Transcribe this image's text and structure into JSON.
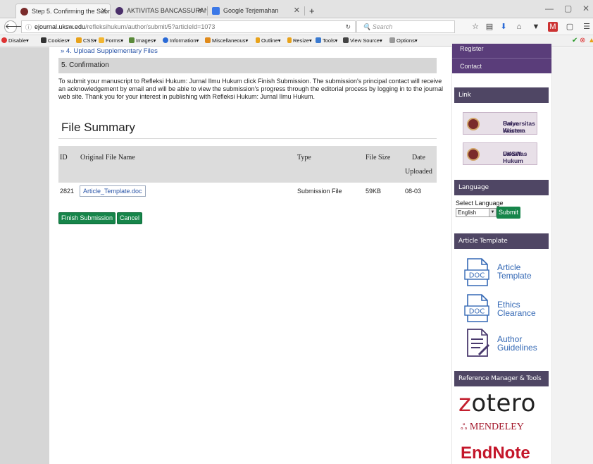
{
  "browser": {
    "tabs": [
      {
        "title": "Step 5. Confirming the Subr",
        "active": true
      },
      {
        "title": "AKTIVITAS BANCASSURANS",
        "active": false
      },
      {
        "title": "Google Terjemahan",
        "active": false
      }
    ],
    "new_tab": "+",
    "url_domain": "ejournal.uksw.edu",
    "url_path": "/refleksihukum/author/submit/5?articleId=1073",
    "search_placeholder": "Search"
  },
  "devbar": {
    "items": [
      "Disable",
      "Cookies",
      "CSS",
      "Forms",
      "Images",
      "Information",
      "Miscellaneous",
      "Outline",
      "Resize",
      "Tools",
      "View Source",
      "Options"
    ]
  },
  "main": {
    "step4_link": "» 4. Upload Supplementary Files",
    "step5_header": "5. Confirmation",
    "instructions": "To submit your manuscript to Refleksi Hukum: Jurnal Ilmu Hukum click Finish Submission. The submission's principal contact will receive an acknowledgement by email and will be able to view the submission's progress through the editorial process by logging in to the journal web site. Thank you for your interest in publishing with Refleksi Hukum: Jurnal Ilmu Hukum.",
    "file_summary_title": "File Summary",
    "table": {
      "headers": {
        "id": "ID",
        "name": "Original File Name",
        "type": "Type",
        "size": "File Size",
        "date_line1": "Date",
        "date_line2": "Uploaded"
      },
      "rows": [
        {
          "id": "2821",
          "name": "Article_Template.doc",
          "type": "Submission File",
          "size": "59KB",
          "date": "08-03"
        }
      ]
    },
    "finish_button": "Finish Submission",
    "cancel_button": "Cancel"
  },
  "sidebar": {
    "nav": [
      "Register",
      "Contact"
    ],
    "link_header": "Link",
    "banners": [
      {
        "line1": "Universitas Kristen",
        "line2": "Satya Wacana"
      },
      {
        "line1": "Fakultas Hukum",
        "line2": "UKSW"
      }
    ],
    "language_header": "Language",
    "select_language_label": "Select Language",
    "language_value": "English",
    "submit_button": "Submit",
    "article_template_header": "Article Template",
    "templates": [
      {
        "icon_text": "DOC",
        "line1": "Article",
        "line2": "Template"
      },
      {
        "icon_text": "DOC",
        "line1": "Ethics",
        "line2": "Clearance"
      },
      {
        "icon_text": "",
        "line1": "Author",
        "line2": "Guidelines"
      }
    ],
    "reference_header": "Reference Manager & Tools",
    "brands": [
      "zotero",
      "MENDELEY",
      "EndNote"
    ]
  },
  "colors": {
    "purple_nav": "#5a3d7a",
    "section_header": "#4f4664",
    "green_button": "#16854a",
    "link_blue": "#2a55a8"
  }
}
